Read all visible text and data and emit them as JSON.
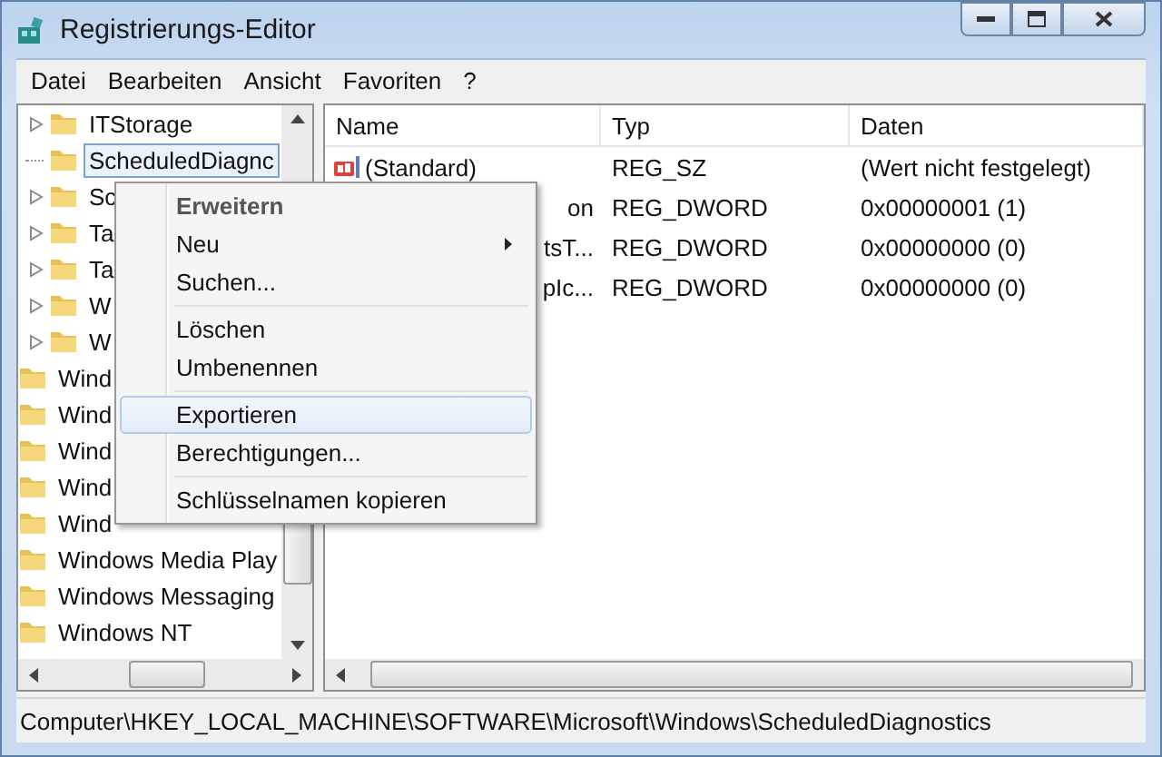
{
  "window": {
    "title": "Registrierungs-Editor"
  },
  "menu_bar": [
    "Datei",
    "Bearbeiten",
    "Ansicht",
    "Favoriten",
    "?"
  ],
  "tree": {
    "items": [
      {
        "children": [
          {
            "label": "ITStorage",
            "expandable": true,
            "selected": false
          },
          {
            "label": "ScheduledDiagnc",
            "expandable": false,
            "selected": true
          },
          {
            "label": "Sc",
            "expandable": true,
            "selected": false
          },
          {
            "label": "Ta",
            "expandable": true,
            "selected": false
          },
          {
            "label": "Ta",
            "expandable": true,
            "selected": false
          },
          {
            "label": "W",
            "expandable": true,
            "selected": false
          },
          {
            "label": "W",
            "expandable": true,
            "selected": false
          }
        ]
      },
      {
        "label": "Wind",
        "expandable": false,
        "selected": false
      },
      {
        "label": "Wind",
        "expandable": false,
        "selected": false
      },
      {
        "label": "Wind",
        "expandable": false,
        "selected": false
      },
      {
        "label": "Wind",
        "expandable": false,
        "selected": false
      },
      {
        "label": "Wind",
        "expandable": false,
        "selected": false
      },
      {
        "label": "Windows Media Play",
        "expandable": false,
        "selected": false
      },
      {
        "label": "Windows Messaging",
        "expandable": false,
        "selected": false
      },
      {
        "label": "Windows NT",
        "expandable": false,
        "selected": false
      }
    ]
  },
  "list": {
    "columns": [
      "Name",
      "Typ",
      "Daten"
    ],
    "rows": [
      {
        "kind": "string",
        "name": "(Standard)",
        "type": "REG_SZ",
        "data": "(Wert nicht festgelegt)"
      },
      {
        "kind": "dword",
        "name": "on",
        "type": "REG_DWORD",
        "data": "0x00000001 (1)"
      },
      {
        "kind": "dword",
        "name": "tsT...",
        "type": "REG_DWORD",
        "data": "0x00000000 (0)"
      },
      {
        "kind": "dword",
        "name": "pIc...",
        "type": "REG_DWORD",
        "data": "0x00000000 (0)"
      }
    ]
  },
  "context_menu": [
    {
      "kind": "item",
      "label": "Erweitern",
      "default": true,
      "submenu": false,
      "selected": false
    },
    {
      "kind": "item",
      "label": "Neu",
      "default": false,
      "submenu": true,
      "selected": false
    },
    {
      "kind": "item",
      "label": "Suchen...",
      "default": false,
      "submenu": false,
      "selected": false
    },
    {
      "kind": "separator"
    },
    {
      "kind": "item",
      "label": "Löschen",
      "default": false,
      "submenu": false,
      "selected": false
    },
    {
      "kind": "item",
      "label": "Umbenennen",
      "default": false,
      "submenu": false,
      "selected": false
    },
    {
      "kind": "separator"
    },
    {
      "kind": "item",
      "label": "Exportieren",
      "default": false,
      "submenu": false,
      "selected": true
    },
    {
      "kind": "item",
      "label": "Berechtigungen...",
      "default": false,
      "submenu": false,
      "selected": false
    },
    {
      "kind": "separator"
    },
    {
      "kind": "item",
      "label": "Schlüsselnamen kopieren",
      "default": false,
      "submenu": false,
      "selected": false
    }
  ],
  "status_bar": "Computer\\HKEY_LOCAL_MACHINE\\SOFTWARE\\Microsoft\\Windows\\ScheduledDiagnostics"
}
